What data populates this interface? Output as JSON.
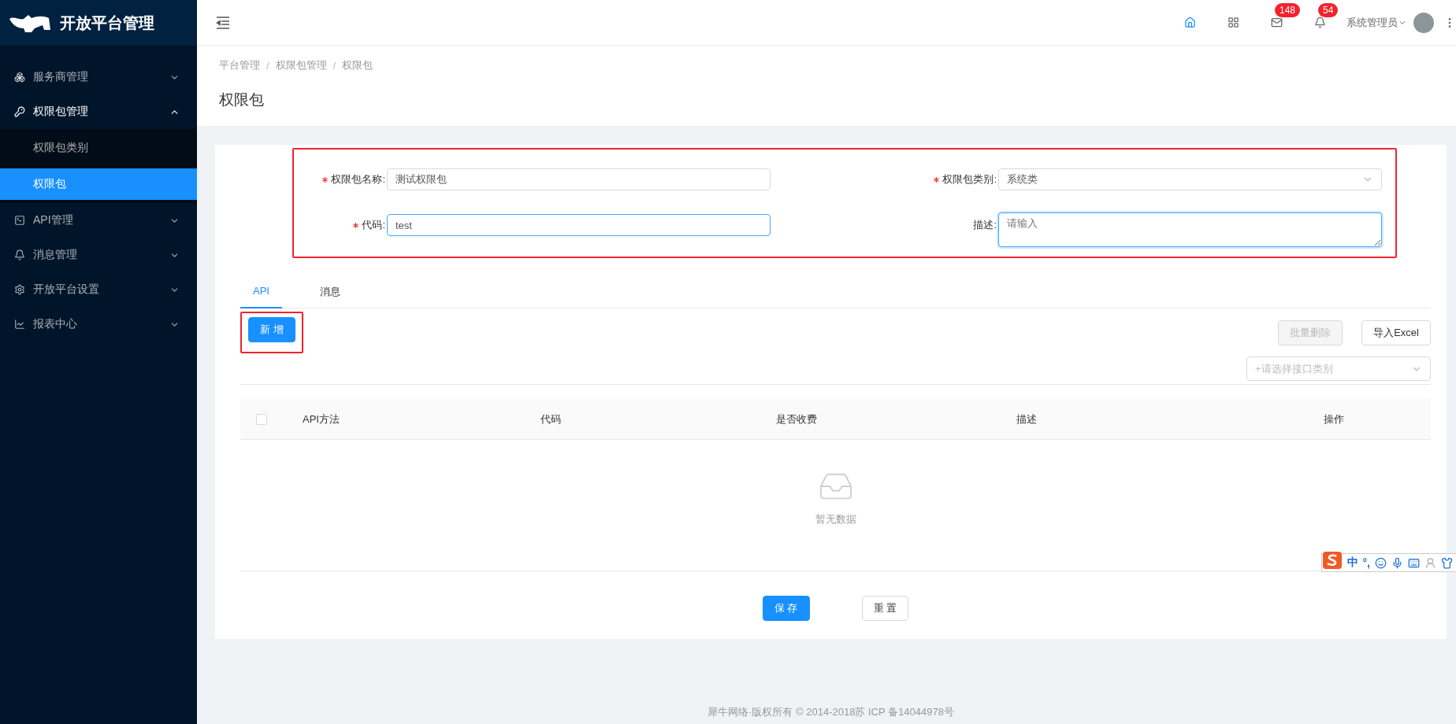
{
  "sidebar": {
    "title": "开放平台管理",
    "items": [
      {
        "label": "服务商管理",
        "expanded": false
      },
      {
        "label": "权限包管理",
        "expanded": true,
        "children": [
          {
            "label": "权限包类别",
            "selected": false
          },
          {
            "label": "权限包",
            "selected": true
          }
        ]
      },
      {
        "label": "API管理",
        "expanded": false
      },
      {
        "label": "消息管理",
        "expanded": false
      },
      {
        "label": "开放平台设置",
        "expanded": false
      },
      {
        "label": "报表中心",
        "expanded": false
      }
    ]
  },
  "header": {
    "actions": [
      {
        "kind": "home",
        "selected": true
      },
      {
        "kind": "apps",
        "selected": false
      },
      {
        "kind": "mail",
        "selected": false,
        "badge": "148"
      },
      {
        "kind": "bell",
        "selected": false,
        "badge": "54"
      }
    ],
    "user": {
      "name": "系统管理员"
    }
  },
  "breadcrumb": [
    {
      "label": "平台管理"
    },
    {
      "separator": "/",
      "label": "权限包管理"
    },
    {
      "separator": "/",
      "label": "权限包"
    }
  ],
  "page_title": "权限包",
  "form": {
    "fields": [
      {
        "kind": "input",
        "label": "权限包名称:",
        "required": true,
        "value": "测试权限包",
        "focused": false
      },
      {
        "kind": "select",
        "label": "权限包类别:",
        "required": true,
        "value": "系统类",
        "focused": false
      },
      {
        "kind": "input",
        "label": "代码:",
        "required": true,
        "value": "test",
        "focused": true
      },
      {
        "kind": "textarea",
        "label": "描述:",
        "required": false,
        "placeholder": "请输入",
        "focused": true
      }
    ]
  },
  "tabs": [
    {
      "label": "API",
      "selected": true
    },
    {
      "label": "消息",
      "selected": false
    }
  ],
  "toolbar": {
    "add_button": "新 增",
    "batch_delete": {
      "label": "批量删除",
      "disabled": true
    },
    "import_button": "导入Excel",
    "category_select": {
      "placeholder": "+请选择接口类别"
    }
  },
  "table": {
    "select_all": {
      "checked": false
    },
    "columns": [
      "API方法",
      "代码",
      "是否收费",
      "描述",
      "操作"
    ],
    "empty_text": "暂无数据"
  },
  "form_actions": [
    {
      "kind": "primary",
      "label": "保 存"
    },
    {
      "kind": "default",
      "label": "重 置"
    }
  ],
  "ime": {
    "mode": "中",
    "punct": "°,"
  },
  "footer": "犀牛网络·版权所有 © 2014-2018苏 ICP 备14044978号"
}
